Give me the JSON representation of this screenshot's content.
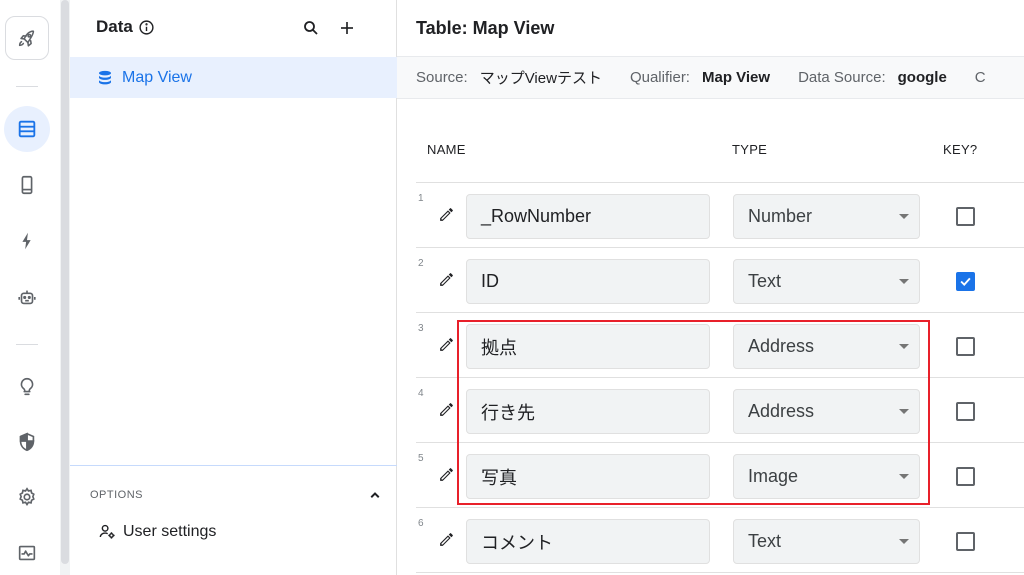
{
  "rail": {
    "icons": [
      "rocket-icon",
      "data-table-icon",
      "phone-icon",
      "bolt-icon",
      "robot-icon",
      "lightbulb-icon",
      "shield-icon",
      "gear-icon",
      "monitor-icon"
    ],
    "active": "data-table-icon",
    "accent": "#1a73e8"
  },
  "panel": {
    "title": "Data",
    "selected_item": "Map View",
    "options_label": "OPTIONS",
    "user_settings": "User settings"
  },
  "main": {
    "title": "Table: Map View",
    "infobar": {
      "source_label": "Source:",
      "source_value": "マップViewテスト",
      "qualifier_label": "Qualifier:",
      "qualifier_value": "Map View",
      "datasource_label": "Data Source:",
      "datasource_value": "google",
      "truncated": "C"
    },
    "columns": {
      "name": "NAME",
      "type": "TYPE",
      "key": "KEY?"
    },
    "rows": [
      {
        "num": "1",
        "name": "_RowNumber",
        "type": "Number",
        "key": false
      },
      {
        "num": "2",
        "name": "ID",
        "type": "Text",
        "key": true
      },
      {
        "num": "3",
        "name": "拠点",
        "type": "Address",
        "key": false
      },
      {
        "num": "4",
        "name": "行き先",
        "type": "Address",
        "key": false
      },
      {
        "num": "5",
        "name": "写真",
        "type": "Image",
        "key": false
      },
      {
        "num": "6",
        "name": "コメント",
        "type": "Text",
        "key": false
      }
    ],
    "highlight_color": "#e8202a"
  }
}
